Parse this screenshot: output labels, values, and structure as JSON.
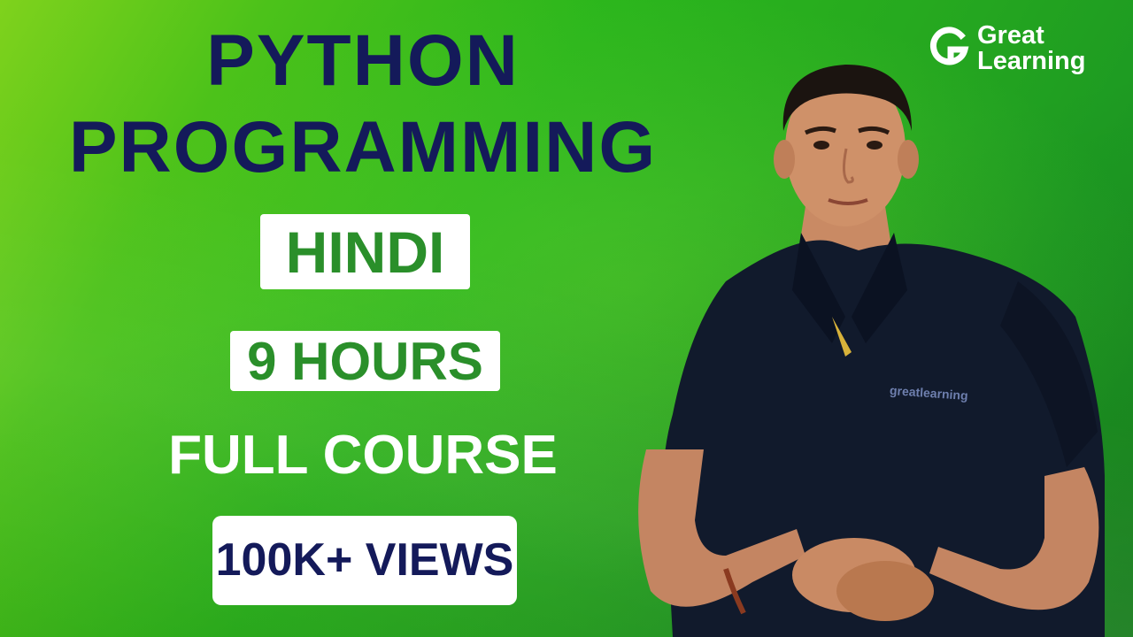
{
  "title_line_1": "PYTHON",
  "title_line_2": "PROGRAMMING",
  "language_badge": "HINDI",
  "duration_badge": "9 HOURS",
  "course_label": "FULL COURSE",
  "views_badge": "100K+ VIEWS",
  "logo": {
    "line_1": "Great",
    "line_2": "Learning",
    "icon": "great-learning-g-logo"
  },
  "shirt_brand": "greatlearning",
  "colors": {
    "background": "#2bb61c",
    "title": "#141a5a",
    "badge_text_green": "#2a8f2a",
    "badge_bg": "#ffffff",
    "course_label": "#ffffff"
  }
}
